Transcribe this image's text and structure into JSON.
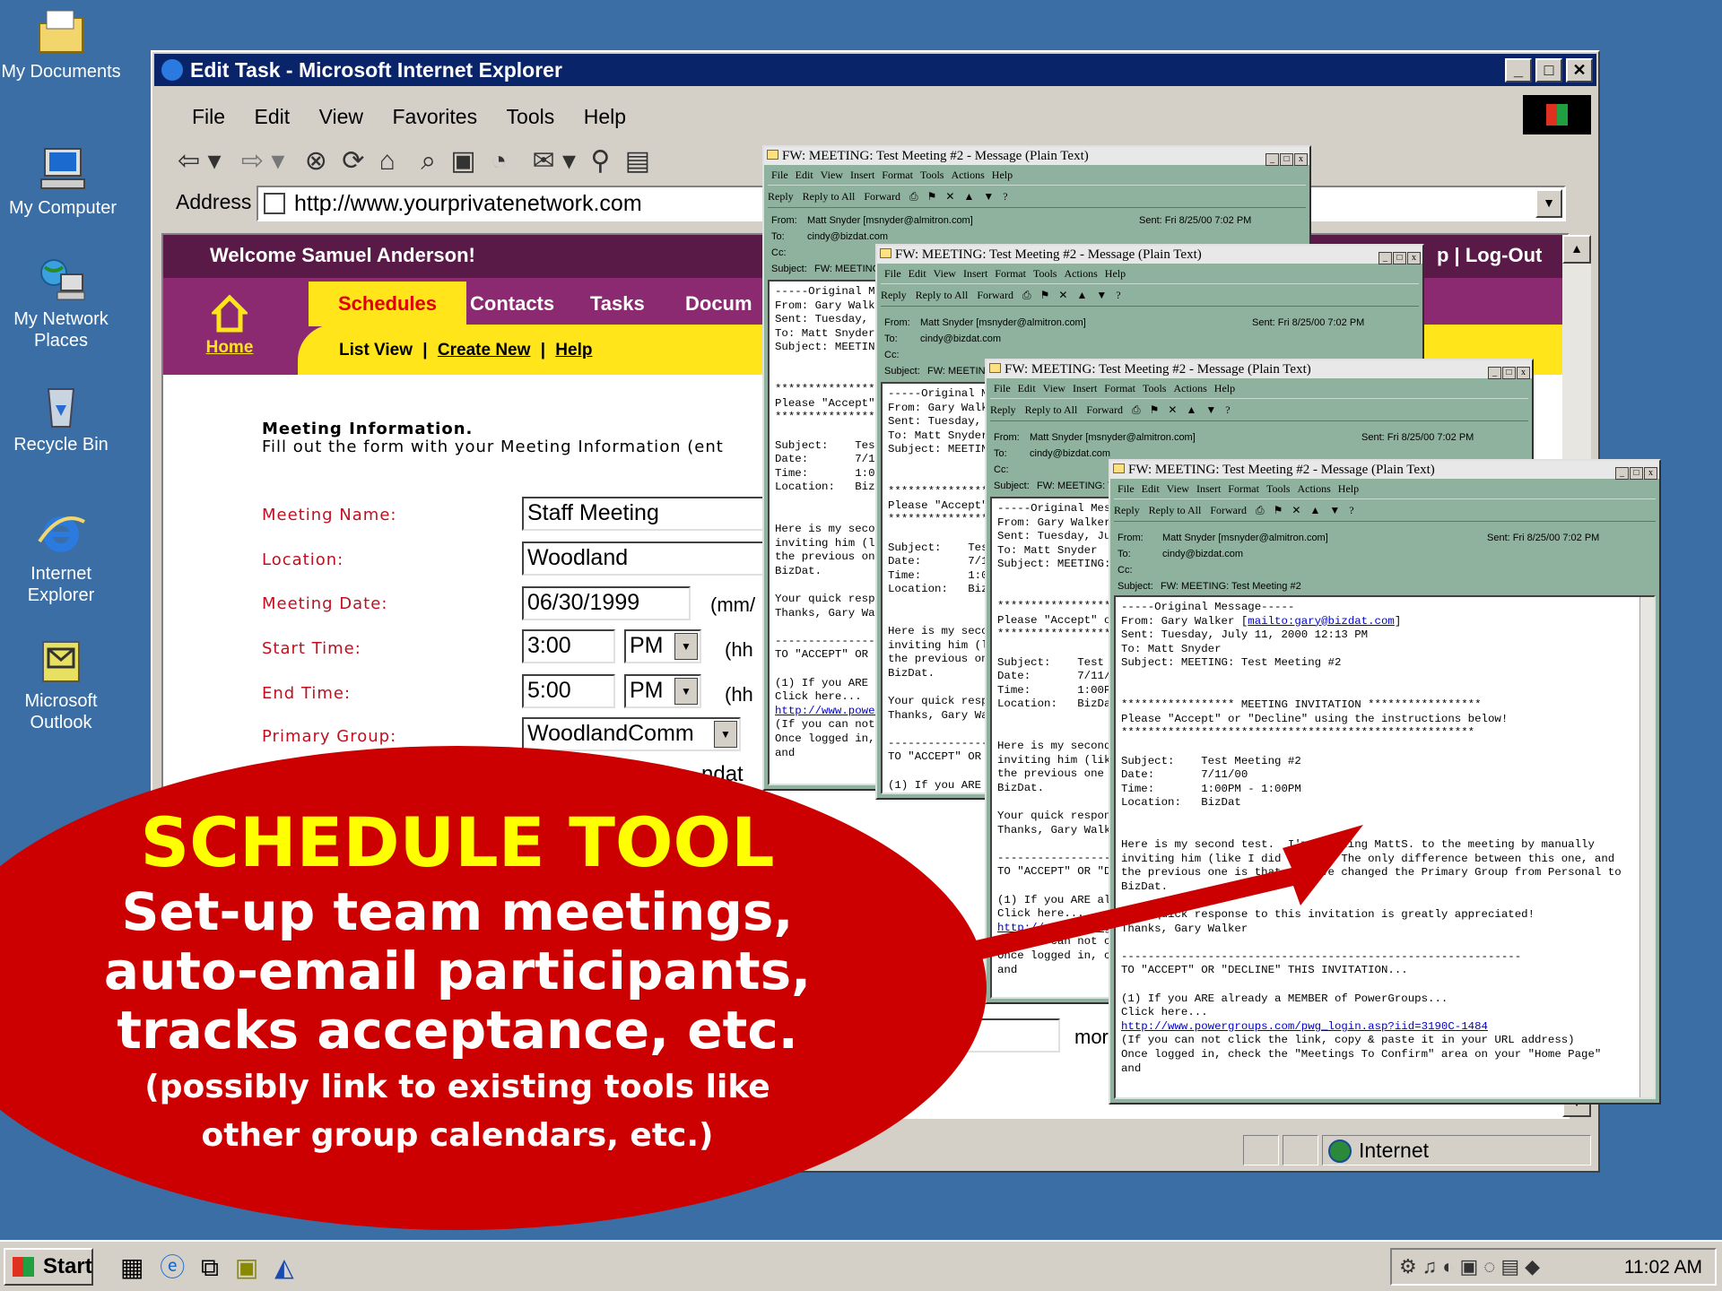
{
  "desktop": {
    "icons": [
      {
        "label": "My Documents",
        "icon": "folder-icon"
      },
      {
        "label": "My Computer",
        "icon": "computer-icon"
      },
      {
        "label": "My Network Places",
        "icon": "network-icon"
      },
      {
        "label": "Recycle Bin",
        "icon": "recycle-bin-icon"
      },
      {
        "label": "Internet Explorer",
        "icon": "internet-explorer-icon"
      },
      {
        "label": "Microsoft Outlook",
        "icon": "outlook-icon"
      }
    ]
  },
  "ie": {
    "title": "Edit Task - Microsoft Internet Explorer",
    "menu": [
      "File",
      "Edit",
      "View",
      "Favorites",
      "Tools",
      "Help"
    ],
    "address_label": "Address",
    "url": "http://www.yourprivatenetwork.com",
    "status_zone": "Internet"
  },
  "page": {
    "welcome": "Welcome Samuel Anderson!",
    "header_right": "p | Log-Out",
    "home_label": "Home",
    "tabs": [
      "Schedules",
      "Contacts",
      "Tasks",
      "Docum"
    ],
    "sublinks": {
      "list_view": "List View",
      "sep": "|",
      "create_new": "Create New",
      "help": "Help"
    },
    "form": {
      "heading": "Meeting Information.",
      "instructions": "Fill out the form with your Meeting Information (ent",
      "meeting_name_label": "Meeting Name:",
      "meeting_name": "Staff Meeting",
      "location_label": "Location:",
      "location": "Woodland",
      "meeting_date_label": "Meeting Date:",
      "meeting_date": "06/30/1999",
      "date_hint": "(mm/",
      "start_time_label": "Start Time:",
      "start_time": "3:00",
      "start_ampm": "PM",
      "time_hint": "(hh",
      "end_time_label": "End Time:",
      "end_time": "5:00",
      "end_ampm": "PM",
      "primary_group_label": "Primary Group:",
      "primary_group": "WoodlandComm",
      "partial_text": "ndat",
      "partial_more": "mor"
    }
  },
  "message": {
    "title": "FW: MEETING: Test Meeting #2 - Message (Plain Text)",
    "menu": [
      "File",
      "Edit",
      "View",
      "Insert",
      "Format",
      "Tools",
      "Actions",
      "Help"
    ],
    "toolbar": [
      "Reply",
      "Reply to All",
      "Forward"
    ],
    "from_label": "From:",
    "from": "Matt Snyder [msnyder@almitron.com]",
    "to_label": "To:",
    "to": "cindy@bizdat.com",
    "cc_label": "Cc:",
    "subject_label": "Subject:",
    "subject": "FW: MEETING: Test Meeting #2",
    "sent": "Sent:   Fri 8/25/00 7:02 PM",
    "body_lines": [
      "-----Original Message-----",
      "From: Gary Walker [mailto:gary@bizdat.com]",
      "Sent: Tuesday, July 11, 2000 12:13 PM",
      "To: Matt Snyder",
      "Subject: MEETING: Test Meeting #2",
      "",
      "",
      "***************** MEETING INVITATION *****************",
      "Please \"Accept\" or \"Decline\" using the instructions below!",
      "*****************************************************",
      "",
      "Subject:    Test Meeting #2",
      "Date:       7/11/00",
      "Time:       1:00PM - 1:00PM",
      "Location:   BizDat",
      "",
      "",
      "Here is my second test.  I'm inviting MattS. to the meeting by manually",
      "inviting him (like I did Ryan).  The only difference between this one, and",
      "the previous one is that, I have changed the Primary Group from Personal to",
      "BizDat.",
      "",
      "Your quick response to this invitation is greatly appreciated!",
      "Thanks, Gary Walker",
      "",
      "------------------------------------------------------------",
      "TO \"ACCEPT\" OR \"DECLINE\" THIS INVITATION...",
      "",
      "(1) If you ARE already a MEMBER of PowerGroups...",
      "Click here...",
      "http://www.powergroups.com/pwg_login.asp?iid=3190C-1484",
      "(If you can not click the link, copy & paste it in your URL address)",
      "Once logged in, check the \"Meetings To Confirm\" area on your \"Home Page\"",
      "and"
    ]
  },
  "callout": {
    "title": "SCHEDULE TOOL",
    "line1": "Set-up team meetings,",
    "line2": "auto-email participants,",
    "line3": "tracks acceptance, etc.",
    "line4": "(possibly link to existing tools like",
    "line5": "other group calendars, etc.)"
  },
  "taskbar": {
    "start": "Start",
    "clock": "11:02 AM"
  },
  "colors": {
    "desktop": "#3a6ea5",
    "callout_red": "#cc0000",
    "callout_yellow": "#ffff00",
    "nav_purple": "#8b2a70",
    "nav_yellow": "#ffe51a",
    "outlook_green": "#8fb29e"
  }
}
